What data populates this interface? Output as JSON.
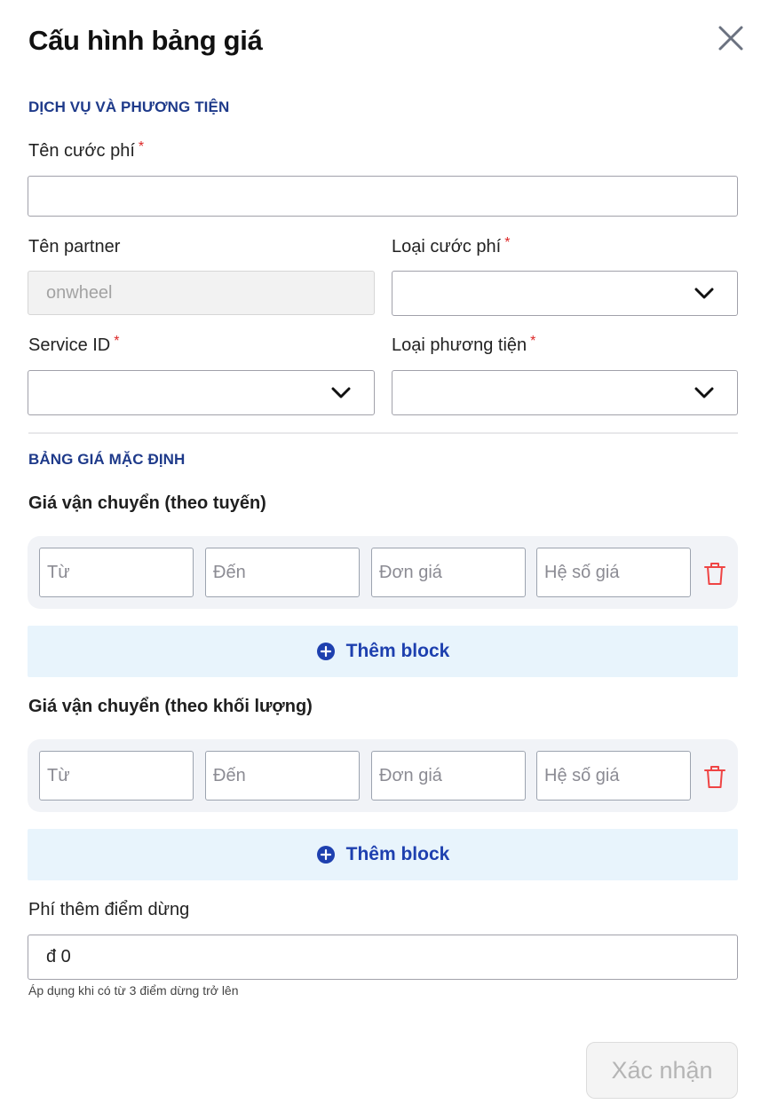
{
  "modal": {
    "title": "Cấu hình bảng giá",
    "close_icon": "close-icon"
  },
  "service_section": {
    "heading": "DỊCH VỤ VÀ PHƯƠNG TIỆN",
    "fee_name": {
      "label": "Tên cước phí",
      "required": "*",
      "value": ""
    },
    "partner_name": {
      "label": "Tên partner",
      "value": "onwheel",
      "disabled": true
    },
    "fee_type": {
      "label": "Loại cước phí",
      "required": "*",
      "selected": ""
    },
    "service_id": {
      "label": "Service ID",
      "required": "*",
      "selected": ""
    },
    "vehicle_type": {
      "label": "Loại phương tiện",
      "required": "*",
      "selected": ""
    }
  },
  "default_pricing": {
    "heading": "BẢNG GIÁ MẶC ĐỊNH",
    "route_pricing": {
      "title": "Giá vận chuyển (theo tuyến)",
      "blocks": [
        {
          "from_placeholder": "Từ",
          "to_placeholder": "Đến",
          "unit_price_placeholder": "Đơn giá",
          "coefficient_placeholder": "Hệ số giá"
        }
      ],
      "add_label": "Thêm block"
    },
    "weight_pricing": {
      "title": "Giá vận chuyển (theo khối lượng)",
      "blocks": [
        {
          "from_placeholder": "Từ",
          "to_placeholder": "Đến",
          "unit_price_placeholder": "Đơn giá",
          "coefficient_placeholder": "Hệ số giá"
        }
      ],
      "add_label": "Thêm block"
    },
    "stop_fee": {
      "label": "Phí thêm điểm dừng",
      "value": "đ 0",
      "hint": "Áp dụng khi có từ 3 điểm dừng trở lên"
    }
  },
  "footer": {
    "submit_label": "Xác nhận",
    "submit_disabled": true
  },
  "colors": {
    "section_heading": "#1e3a8a",
    "required_mark": "#dc2626",
    "add_block_bg": "#e8f4fc",
    "add_block_text": "#1e40af",
    "delete_icon": "#ef4444"
  }
}
